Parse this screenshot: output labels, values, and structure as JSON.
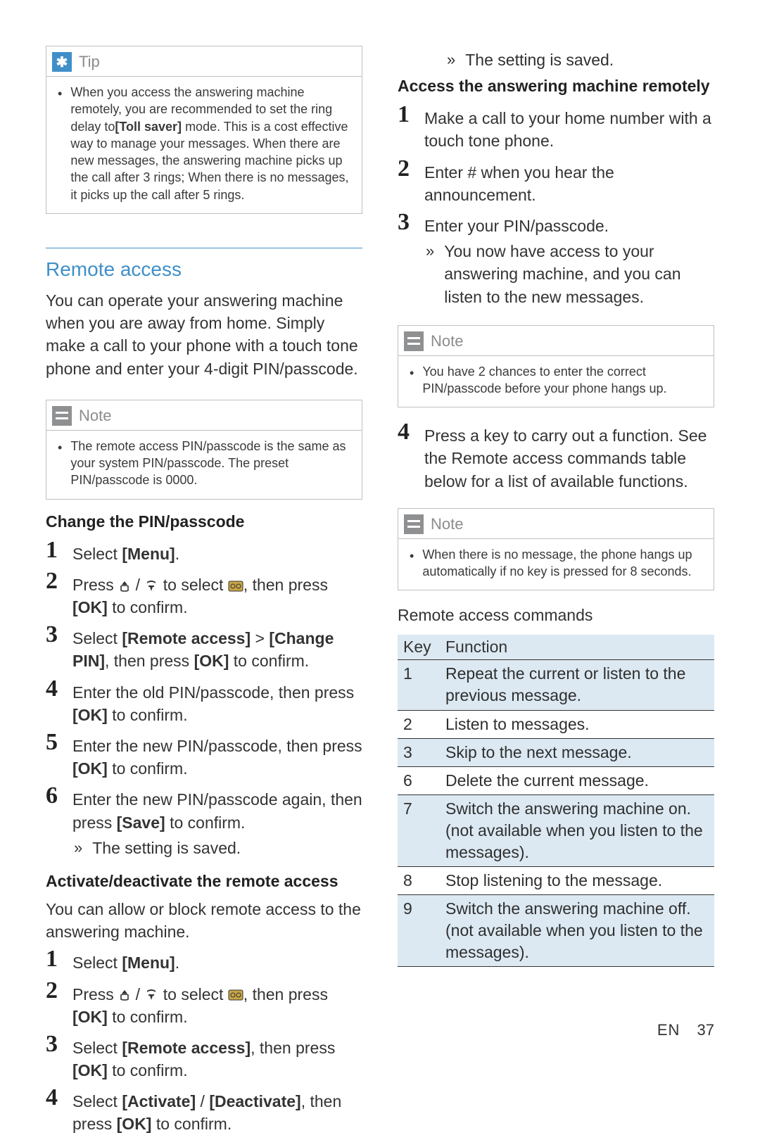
{
  "left": {
    "tip": {
      "title": "Tip",
      "text": "When you access the answering machine remotely, you are recommended to set the ring delay to[Toll saver] mode. This is a cost effective way to manage your messages. When there are new messages, the answering machine picks up the call after 3 rings; When there is no messages, it picks up the call after 5 rings.",
      "bold1": "[Toll saver]"
    },
    "remote_access": {
      "heading": "Remote access",
      "intro": "You can operate your answering machine when you are away from home. Simply make a call to your phone with a touch tone phone and enter your 4-digit PIN/passcode."
    },
    "note1": {
      "title": "Note",
      "text": "The remote access PIN/passcode is the same as your system PIN/passcode. The preset PIN/passcode is 0000."
    },
    "change_pin": {
      "heading": "Change the PIN/passcode",
      "s1": "Select [Menu].",
      "s1_bold": "[Menu]",
      "s2a": "Press ",
      "s2b": " to select ",
      "s2c": ", then press [OK] to confirm.",
      "s2_bold": "[OK]",
      "s3": "Select [Remote access] > [Change PIN], then press [OK] to confirm.",
      "s3_b1": "[Remote access]",
      "s3_b2": "[Change PIN]",
      "s3_b3": "[OK]",
      "s4": "Enter the old PIN/passcode, then press [OK] to confirm.",
      "s4_bold": "[OK]",
      "s5": "Enter the new PIN/passcode, then press [OK] to confirm.",
      "s5_bold": "[OK]",
      "s6": "Enter the new PIN/passcode again, then press [Save] to confirm.",
      "s6_bold": "[Save]",
      "s6_sub": "The setting is saved."
    },
    "activate": {
      "heading": "Activate/deactivate the remote access",
      "intro": "You can allow or block remote access to the answering machine.",
      "s1": "Select [Menu].",
      "s1_bold": "[Menu]",
      "s2a": "Press ",
      "s2b": " to select ",
      "s2c": ", then press [OK] to confirm.",
      "s2_bold": "[OK]",
      "s3": "Select [Remote access], then press [OK] to confirm.",
      "s3_b1": "[Remote access]",
      "s3_b2": "[OK]",
      "s4": "Select [Activate] / [Deactivate], then press [OK] to confirm.",
      "s4_b1": "[Activate]",
      "s4_b2": "[Deactivate]",
      "s4_b3": "[OK]"
    }
  },
  "right": {
    "top_sub": "The setting is saved.",
    "access_remote": {
      "heading": "Access the answering machine remotely",
      "s1": "Make a call to your home number with a touch tone phone.",
      "s2": "Enter # when you hear the announcement.",
      "s3": "Enter your PIN/passcode.",
      "s3_sub": "You now have access to your answering machine, and you can listen to the new messages."
    },
    "note2": {
      "title": "Note",
      "text": "You have 2 chances to enter the correct PIN/passcode before your phone hangs up."
    },
    "step4": "Press a key to carry out a function. See the Remote access commands table below for a list of available functions.",
    "note3": {
      "title": "Note",
      "text": "When there is no message, the phone hangs up automatically if no key is pressed for 8 seconds."
    },
    "table": {
      "heading": "Remote access commands",
      "col_key": "Key",
      "col_func": "Function",
      "rows": [
        {
          "k": "1",
          "f": "Repeat the current or listen to the previous message."
        },
        {
          "k": "2",
          "f": "Listen to messages."
        },
        {
          "k": "3",
          "f": "Skip to the next message."
        },
        {
          "k": "6",
          "f": "Delete the current message."
        },
        {
          "k": "7",
          "f": "Switch the answering machine on. (not available when you listen to the messages)."
        },
        {
          "k": "8",
          "f": "Stop listening to the message."
        },
        {
          "k": "9",
          "f": "Switch the answering machine off. (not available when you listen to the messages)."
        }
      ]
    }
  },
  "footer": {
    "lang": "EN",
    "page": "37"
  }
}
